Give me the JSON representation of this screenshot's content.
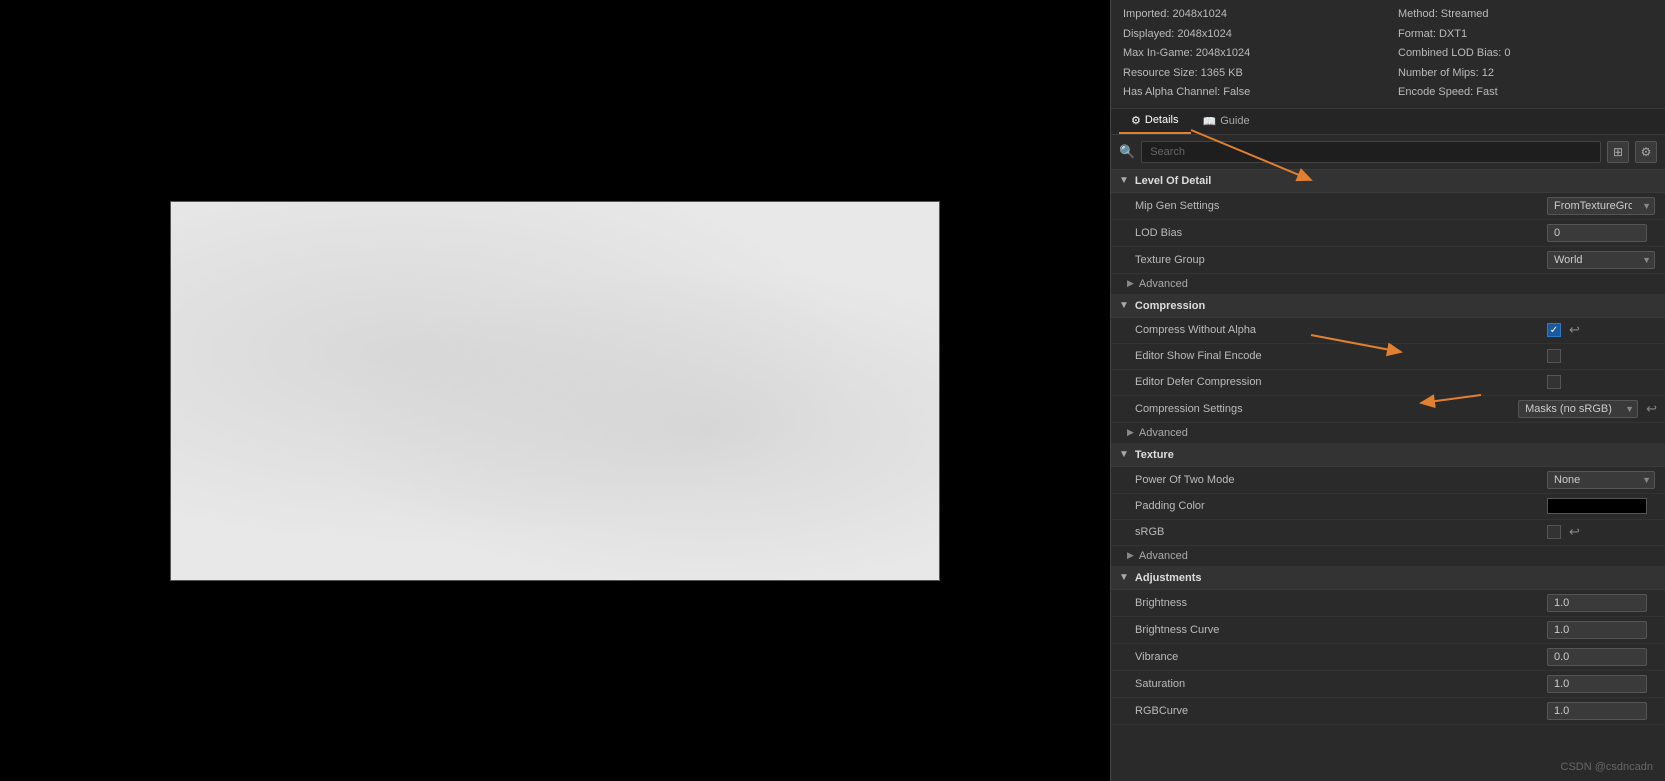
{
  "viewport": {
    "label": "texture-viewport"
  },
  "info": {
    "imported": "Imported: 2048x1024",
    "displayed": "Displayed: 2048x1024",
    "max_in_game": "Max In-Game: 2048x1024",
    "resource_size": "Resource Size: 1365 KB",
    "has_alpha": "Has Alpha Channel: False",
    "method": "Method: Streamed",
    "format": "Format: DXT1",
    "combined_lod_bias": "Combined LOD Bias: 0",
    "number_of_mips": "Number of Mips: 12",
    "encode_speed": "Encode Speed: Fast"
  },
  "tabs": [
    {
      "label": "Details",
      "active": true
    },
    {
      "label": "Guide",
      "active": false
    }
  ],
  "search": {
    "placeholder": "Search"
  },
  "sections": {
    "level_of_detail": {
      "title": "Level Of Detail",
      "expanded": true,
      "properties": [
        {
          "label": "Mip Gen Settings",
          "type": "dropdown",
          "value": "FromTextureGroup"
        },
        {
          "label": "LOD Bias",
          "type": "text",
          "value": "0"
        },
        {
          "label": "Texture Group",
          "type": "dropdown",
          "value": "World"
        }
      ],
      "advanced": {
        "label": "Advanced",
        "expanded": false
      }
    },
    "compression": {
      "title": "Compression",
      "expanded": true,
      "properties": [
        {
          "label": "Compress Without Alpha",
          "type": "checkbox",
          "checked": true
        },
        {
          "label": "Editor Show Final Encode",
          "type": "checkbox",
          "checked": false
        },
        {
          "label": "Editor Defer Compression",
          "type": "checkbox",
          "checked": false
        },
        {
          "label": "Compression Settings",
          "type": "dropdown",
          "value": "Masks (no sRGB)",
          "hasReset": true
        }
      ],
      "advanced": {
        "label": "Advanced",
        "expanded": false
      }
    },
    "texture": {
      "title": "Texture",
      "expanded": true,
      "properties": [
        {
          "label": "Power Of Two Mode",
          "type": "dropdown",
          "value": "None"
        },
        {
          "label": "Padding Color",
          "type": "color",
          "value": "#000000"
        },
        {
          "label": "sRGB",
          "type": "checkbox",
          "checked": false,
          "hasReset": true
        }
      ],
      "advanced": {
        "label": "Advanced",
        "expanded": false
      }
    },
    "adjustments": {
      "title": "Adjustments",
      "expanded": true,
      "properties": [
        {
          "label": "Brightness",
          "type": "number",
          "value": "1.0"
        },
        {
          "label": "Brightness Curve",
          "type": "number",
          "value": "1.0"
        },
        {
          "label": "Vibrance",
          "type": "number",
          "value": "0.0"
        },
        {
          "label": "Saturation",
          "type": "number",
          "value": "1.0"
        },
        {
          "label": "RGBCurve",
          "type": "number",
          "value": "1.0"
        }
      ]
    }
  },
  "arrows": [
    {
      "id": "arrow1",
      "color": "#e08030"
    },
    {
      "id": "arrow2",
      "color": "#e08030"
    },
    {
      "id": "arrow3",
      "color": "#e08030"
    }
  ],
  "watermark": "CSDN @csdncadn"
}
